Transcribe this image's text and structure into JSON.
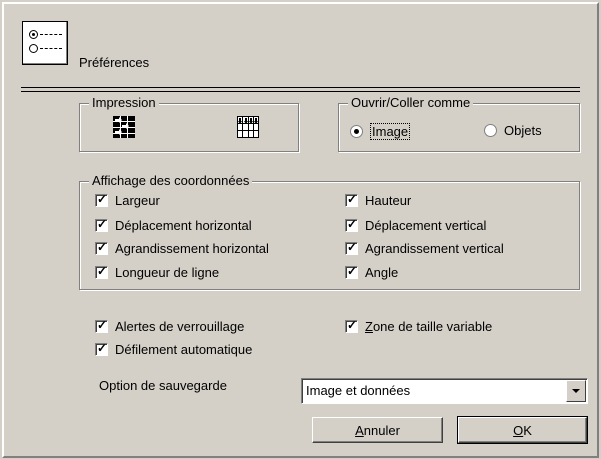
{
  "header": {
    "title": "Préférences",
    "icon": "radio-list-icon"
  },
  "impression": {
    "legend": "Impression",
    "icons": [
      "print-layout-horizontal-icon",
      "print-layout-vertical-icon"
    ]
  },
  "ouvrir": {
    "legend": "Ouvrir/Coller comme",
    "options": [
      {
        "label": "Image",
        "selected": true
      },
      {
        "label": "Objets",
        "selected": false
      }
    ]
  },
  "coords": {
    "legend": "Affichage des coordonnées",
    "left": [
      {
        "label": "Largeur",
        "checked": true
      },
      {
        "label": "Déplacement horizontal",
        "checked": true
      },
      {
        "label": "Agrandissement horizontal",
        "checked": true
      },
      {
        "label": "Longueur de ligne",
        "checked": true
      }
    ],
    "right": [
      {
        "label": "Hauteur",
        "checked": true
      },
      {
        "label": "Déplacement vertical",
        "checked": true
      },
      {
        "label": "Agrandissement vertical",
        "checked": true
      },
      {
        "label": "Angle",
        "checked": true
      }
    ]
  },
  "misc": {
    "alertes": {
      "label": "Alertes de verrouillage",
      "checked": true
    },
    "defilement": {
      "label": "Défilement automatique",
      "checked": true
    },
    "zone": {
      "label_u": "Z",
      "label_rest": "one de taille variable",
      "checked": true
    }
  },
  "sauvegarde": {
    "label": "Option de sauvegarde",
    "value": "Image et données"
  },
  "buttons": {
    "cancel_u": "A",
    "cancel_rest": "nnuler",
    "ok_u": "O",
    "ok_rest": "K"
  },
  "check_glyph": "✓"
}
